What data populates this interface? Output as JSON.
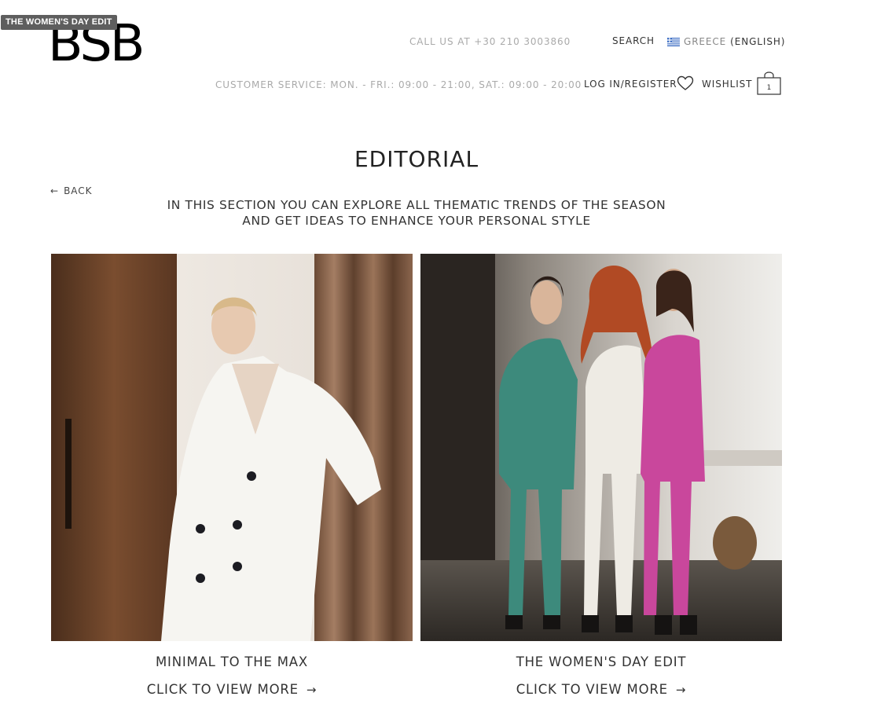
{
  "tooltip": "THE WOMEN'S DAY EDIT",
  "brand": {
    "logo": "BSB"
  },
  "header": {
    "call": "CALL US AT +30 210 3003860",
    "service_hours": "CUSTOMER SERVICE: MON. - FRI.: 09:00 - 21:00, SAT.: 09:00 - 20:00",
    "search": "SEARCH",
    "country": "GREECE",
    "language": "(ENGLISH)",
    "login": "LOG IN/REGISTER",
    "wishlist": "WISHLIST",
    "cart_count": "1"
  },
  "page": {
    "title": "EDITORIAL",
    "back": "BACK",
    "intro_line1": "IN THIS SECTION YOU CAN EXPLORE ALL THEMATIC TRENDS OF THE SEASON",
    "intro_line2": "AND GET IDEAS TO ENHANCE YOUR PERSONAL STYLE"
  },
  "editorials": [
    {
      "title": "MINIMAL TO THE MAX",
      "link": "CLICK TO VIEW MORE"
    },
    {
      "title": "THE WOMEN'S DAY EDIT",
      "link": "CLICK TO VIEW MORE"
    }
  ],
  "icons": [
    "back-arrow-icon",
    "heart-icon",
    "shopping-bag-icon",
    "greece-flag-icon",
    "arrow-right-icon"
  ],
  "colors": {
    "text": "#222222",
    "muted": "#aaaaaa",
    "tooltip_bg": "#5e5e5e"
  }
}
